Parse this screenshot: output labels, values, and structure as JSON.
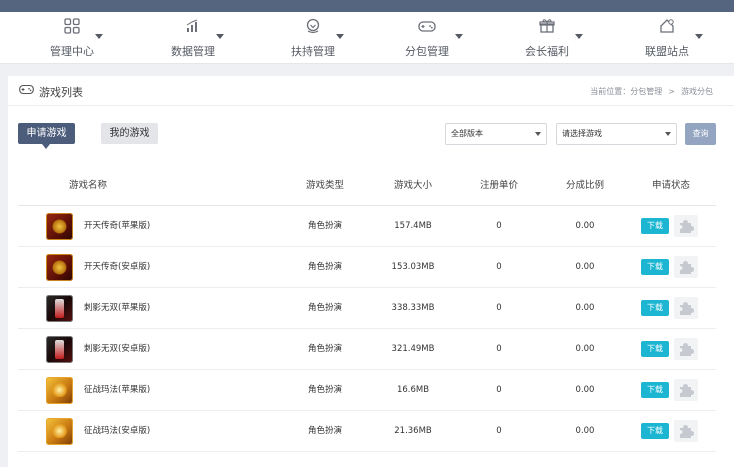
{
  "nav": {
    "items": [
      {
        "label": "管理中心",
        "icon": "grid-icon",
        "glyph": "▦"
      },
      {
        "label": "数据管理",
        "icon": "bar-chart-icon",
        "glyph": "📶"
      },
      {
        "label": "扶持管理",
        "icon": "support-icon",
        "glyph": "◉"
      },
      {
        "label": "分包管理",
        "icon": "gamepad-icon",
        "glyph": "🎮"
      },
      {
        "label": "会长福利",
        "icon": "gift-icon",
        "glyph": "🎁"
      },
      {
        "label": "联盟站点",
        "icon": "home-icon",
        "glyph": "⌂"
      }
    ]
  },
  "panel": {
    "title": "游戏列表",
    "breadcrumb": {
      "prefix": "当前位置：分包管理",
      "sep": ">",
      "current": "游戏分包"
    }
  },
  "tabs": {
    "apply": "申请游戏",
    "mine": "我的游戏"
  },
  "filters": {
    "version": "全部版本",
    "game": "请选择游戏",
    "query_label": "查询"
  },
  "table": {
    "headers": {
      "name": "游戏名称",
      "type": "游戏类型",
      "size": "游戏大小",
      "price": "注册单价",
      "ratio": "分成比例",
      "status": "申请状态"
    },
    "download_label": "下载",
    "rows": [
      {
        "icon": "tx",
        "name": "开天传奇(苹果版)",
        "type": "角色扮演",
        "size": "157.4MB",
        "price": "0",
        "ratio": "0.00"
      },
      {
        "icon": "tx",
        "name": "开天传奇(安卓版)",
        "type": "角色扮演",
        "size": "153.03MB",
        "price": "0",
        "ratio": "0.00"
      },
      {
        "icon": "cy",
        "name": "刺影无双(苹果版)",
        "type": "角色扮演",
        "size": "338.33MB",
        "price": "0",
        "ratio": "0.00"
      },
      {
        "icon": "cy",
        "name": "刺影无双(安卓版)",
        "type": "角色扮演",
        "size": "321.49MB",
        "price": "0",
        "ratio": "0.00"
      },
      {
        "icon": "zz",
        "name": "征战玛法(苹果版)",
        "type": "角色扮演",
        "size": "16.6MB",
        "price": "0",
        "ratio": "0.00"
      },
      {
        "icon": "zz",
        "name": "征战玛法(安卓版)",
        "type": "角色扮演",
        "size": "21.36MB",
        "price": "0",
        "ratio": "0.00"
      }
    ]
  }
}
